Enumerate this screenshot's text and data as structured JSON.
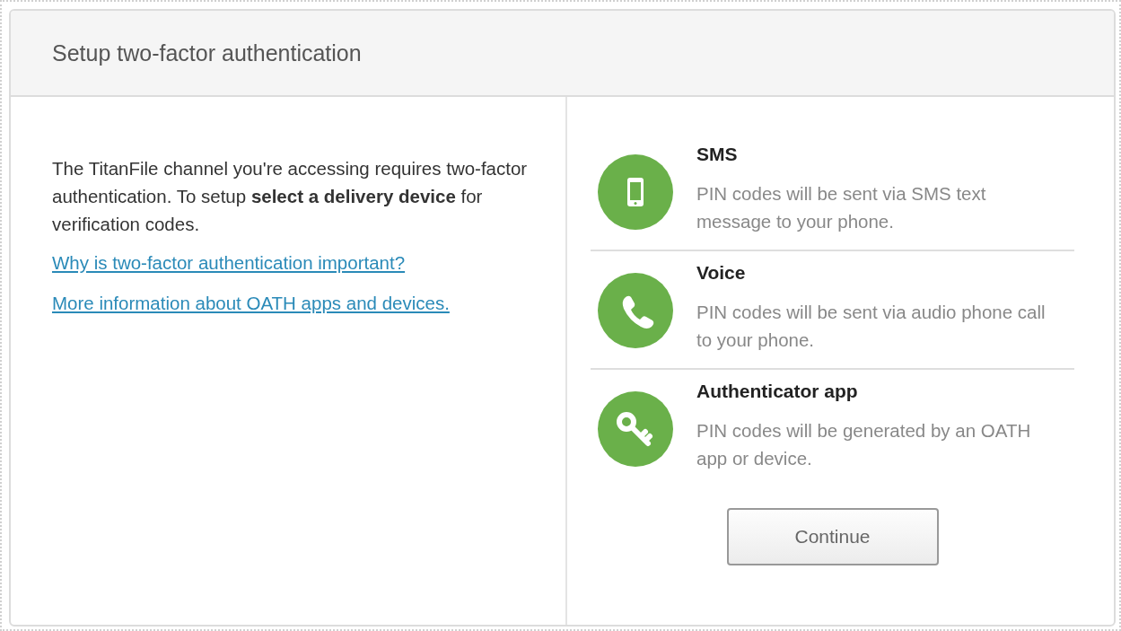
{
  "dialog": {
    "title": "Setup two-factor authentication"
  },
  "intro": {
    "text": "The TitanFile channel you're accessing requires two-factor authentication. To setup **select a delivery device** for verification codes.",
    "links": [
      "Why is two-factor authentication important?",
      "More information about OATH apps and devices."
    ]
  },
  "options": [
    {
      "kind": "sms",
      "title": "SMS",
      "description": "PIN codes will be sent via SMS text message to your phone."
    },
    {
      "kind": "voice",
      "title": "Voice",
      "description": "PIN codes will be sent via audio phone call to your phone."
    },
    {
      "kind": "app",
      "title": "Authenticator app",
      "description": "PIN codes will be generated by an OATH app or device."
    }
  ],
  "button": "Continue"
}
